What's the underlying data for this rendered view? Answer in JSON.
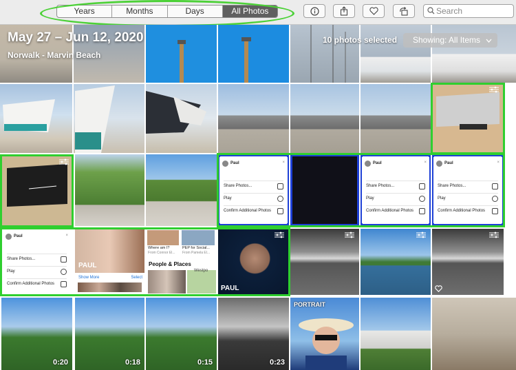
{
  "toolbar": {
    "segments": [
      "Years",
      "Months",
      "Days",
      "All Photos"
    ],
    "active_segment": "All Photos",
    "search_placeholder": "Search",
    "buttons": [
      "info-icon",
      "share-icon",
      "heart-icon",
      "rotate-icon"
    ]
  },
  "header": {
    "date_range": "May 27 – Jun 12, 2020",
    "location": "Norwalk - Marvin Beach",
    "selection_count": "10 photos selected",
    "showing_label": "Showing: All Items"
  },
  "share_sheet": {
    "name": "Paul",
    "close": "×",
    "share": "Share Photos...",
    "play": "Play",
    "confirm": "Confirm Additional Photos"
  },
  "people_card": {
    "where": "Where am I?",
    "where_from": "From Connor El...",
    "pep": "PEP for Social...",
    "pep_from": "From Pamela El...",
    "section": "People & Places",
    "place": "Westpo"
  },
  "face_card": {
    "name": "PAUL",
    "show_more": "Show More",
    "select": "Select"
  },
  "portrait_label": "PORTRAIT",
  "durations": [
    "0:20",
    "0:18",
    "0:15",
    "0:23"
  ],
  "colors": {
    "selection_green": "#2fcf2f",
    "selection_blue": "#1e40d6",
    "annotation_green": "#4cd137"
  }
}
